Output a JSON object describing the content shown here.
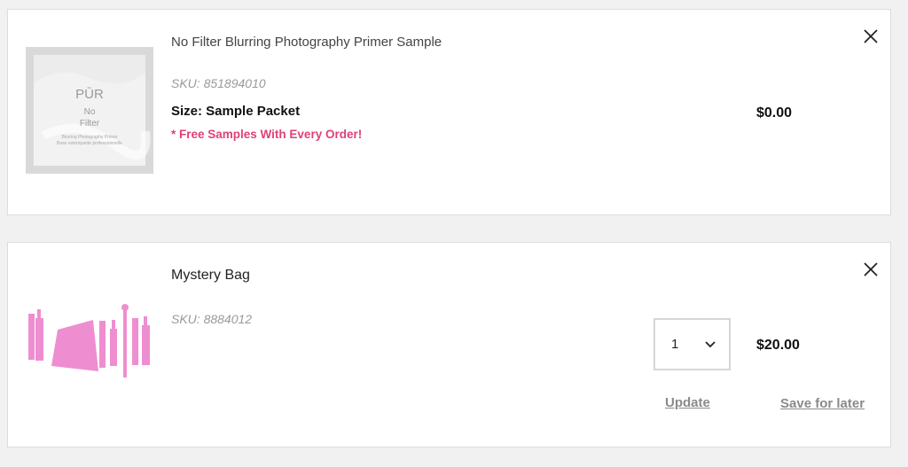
{
  "items": [
    {
      "name": "No Filter Blurring Photography Primer Sample",
      "sku": "SKU: 851894010",
      "size": "Size: Sample Packet",
      "promo": "* Free Samples With Every Order!",
      "price": "$0.00",
      "image": {
        "brand": "PŪR",
        "line1": "No",
        "line2": "Filter",
        "caption1": "Blurring Photography Primer",
        "caption2": "Base estompante professionnelle"
      }
    },
    {
      "name": "Mystery Bag",
      "sku": "SKU: 8884012",
      "price": "$20.00",
      "quantity": "1",
      "update_label": "Update",
      "save_later_label": "Save for later"
    }
  ],
  "colors": {
    "promo": "#e0407a",
    "illustration_pink": "#ee8ed0"
  },
  "icons": {
    "close": "close-icon",
    "chevron": "chevron-down-icon"
  }
}
